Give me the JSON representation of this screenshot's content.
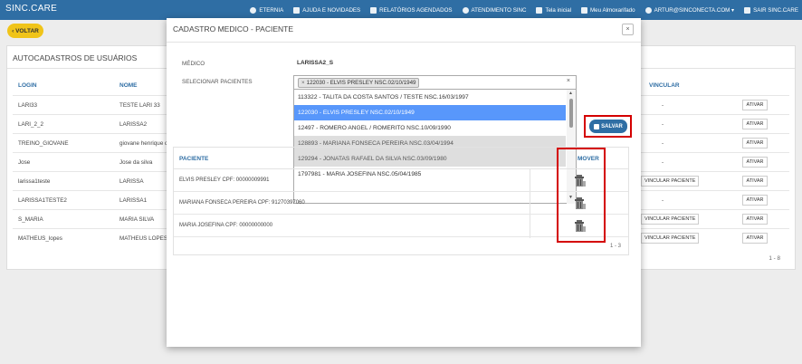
{
  "navbar": {
    "brand": "SINC.CARE",
    "items": [
      {
        "label": "ETERNIA",
        "icon": "chat-icon"
      },
      {
        "label": "AJUDA E NOVIDADES",
        "icon": "rss-icon"
      },
      {
        "label": "RELATÓRIOS AGENDADOS",
        "icon": "calendar-icon"
      },
      {
        "label": "ATENDIMENTO SINC",
        "icon": "info-icon"
      },
      {
        "label": "Tela inicial",
        "icon": "home-icon"
      },
      {
        "label": "Meu Almoxarifado",
        "icon": "edit-icon"
      },
      {
        "label": "ARTUR@SINCONECTA.COM ▾",
        "icon": "user-icon"
      },
      {
        "label": "SAIR SINC.CARE",
        "icon": "signout-icon"
      }
    ]
  },
  "back_label": "‹ VOLTAR",
  "panel": {
    "title": "AUTOCADASTROS DE USUÁRIOS",
    "headers": {
      "login": "LOGIN",
      "nome": "NOME",
      "vincular": "VINCULAR"
    },
    "rows": [
      {
        "login": "LARI33",
        "nome": "TESTE LARI 33",
        "vincular": "-",
        "action": "ATIVAR"
      },
      {
        "login": "LARI_2_2",
        "nome": "LARISSA2",
        "vincular": "-",
        "action": "ATIVAR"
      },
      {
        "login": "TREINO_GIOVANE",
        "nome": "giovane henrique d",
        "vincular": "-",
        "action": "ATIVAR"
      },
      {
        "login": "Jose",
        "nome": "Jose da silva",
        "vincular": "-",
        "action": "ATIVAR"
      },
      {
        "login": "larissa1teste",
        "nome": "LARISSA",
        "vincular": "VINCULAR PACIENTE",
        "action": "ATIVAR"
      },
      {
        "login": "LARISSA1TESTE2",
        "nome": "LARISSA1",
        "vincular": "-",
        "action": "ATIVAR"
      },
      {
        "login": "S_MARIA",
        "nome": "MARIA SILVA",
        "vincular": "VINCULAR PACIENTE",
        "action": "ATIVAR"
      },
      {
        "login": "MATHEUS_lopes",
        "nome": "MATHEUS LOPES",
        "vincular": "VINCULAR PACIENTE",
        "action": "ATIVAR"
      }
    ],
    "footer": "1 - 8"
  },
  "modal": {
    "title": "CADASTRO MEDICO - PACIENTE",
    "close": "×",
    "medico_label": "MÉDICO",
    "medico_value": "LARISSA2_S",
    "select_label": "SELECIONAR PACIENTES",
    "selected_tag": "122030 - ELVIS PRESLEY NSC.02/10/1949",
    "tag_remove": "×",
    "clear": "×",
    "options": [
      {
        "label": "113322 - TALITA DA COSTA SANTOS / TESTE NSC.16/03/1997",
        "state": "normal"
      },
      {
        "label": "122030 - ELVIS PRESLEY NSC.02/10/1949",
        "state": "active"
      },
      {
        "label": "12497 - ROMERO ANGEL / ROMERITO NSC.10/09/1990",
        "state": "normal"
      },
      {
        "label": "128893 - MARIANA FONSECA PEREIRA NSC.03/04/1994",
        "state": "disabled"
      },
      {
        "label": "129294 - JONATAS RAFAEL DA SILVA NSC.03/09/1980",
        "state": "disabled"
      },
      {
        "label": "1797981 - MARIA JOSEFINA NSC.05/04/1985",
        "state": "normal"
      }
    ],
    "save_label": "SALVAR",
    "table_headers": {
      "paciente": "PACIENTE",
      "remover": "MOVER"
    },
    "patients": [
      {
        "label": "ELVIS PRESLEY CPF: 00000009991"
      },
      {
        "label": "MARIANA FONSECA PEREIRA CPF: 91270397060"
      },
      {
        "label": "MARIA JOSEFINA CPF: 00000000000"
      }
    ],
    "table_footer": "1 - 3"
  }
}
